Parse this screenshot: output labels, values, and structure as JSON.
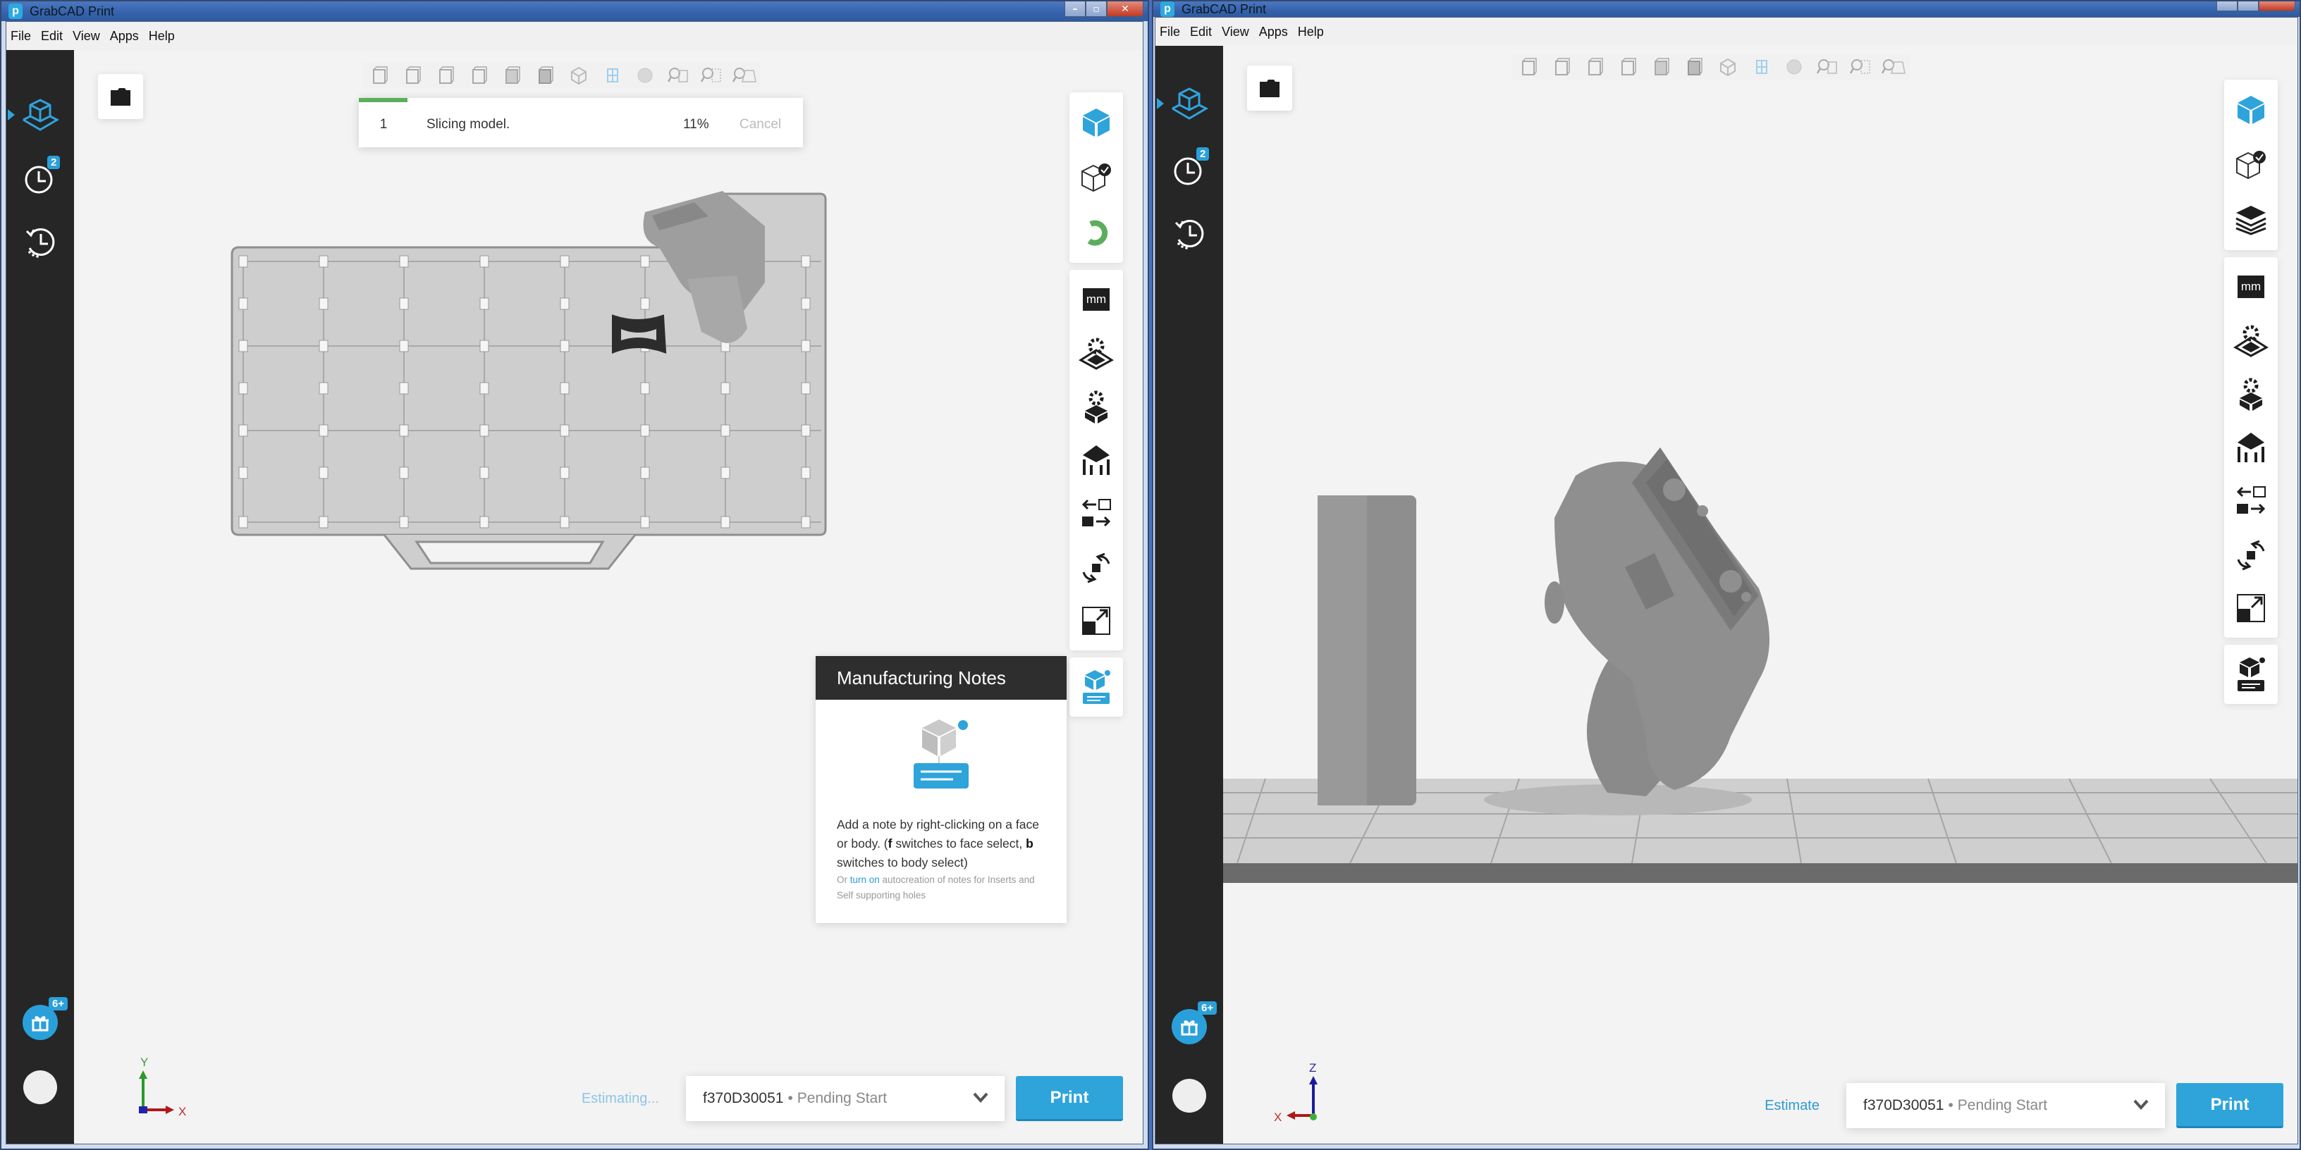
{
  "windows": [
    {
      "title": "GrabCAD Print",
      "menu": [
        "File",
        "Edit",
        "View",
        "Apps",
        "Help"
      ],
      "sidebar": {
        "items": [
          {
            "name": "prepare-icon",
            "active": true
          },
          {
            "name": "queue-icon",
            "badge": "2"
          },
          {
            "name": "history-icon"
          }
        ],
        "bottom": [
          {
            "name": "gift-icon",
            "badge": "6+"
          },
          {
            "name": "avatar"
          }
        ]
      },
      "view_toolbar": [
        "front-view",
        "back-view",
        "left-view",
        "right-view",
        "top-view",
        "bottom-view",
        "isometric-view",
        "wireframe-view",
        "shaded-view",
        "zoom-fit",
        "zoom-selection",
        "zoom-tray"
      ],
      "job": {
        "number": "1",
        "status": "Slicing model.",
        "percent_text": "11%",
        "progress": 0.11,
        "cancel_label": "Cancel"
      },
      "right_toolbar": {
        "group1": [
          "model-view-icon",
          "check-model-icon",
          "slicing-spinner-icon"
        ],
        "group2_units": "mm",
        "group2": [
          "tray-settings-icon",
          "model-settings-icon",
          "supports-icon",
          "arrange-icon",
          "orient-icon",
          "scale-icon"
        ],
        "group3": [
          "manufacturing-notes-icon"
        ]
      },
      "manufacturing_notes": {
        "title": "Manufacturing Notes",
        "text_part1": "Add a note by right-clicking on a face or body. (",
        "key_f": "f",
        "text_part2": " switches to face select, ",
        "key_b": "b",
        "text_part3": " switches to body select)",
        "sub_prefix": "Or ",
        "sub_link": "turn on",
        "sub_suffix": " autocreation of notes for Inserts and Self supporting holes"
      },
      "axes": {
        "vertical": "Y",
        "horizontal": "X"
      },
      "estimate_label": "Estimating...",
      "printer": {
        "name": "f370D30051",
        "separator": "•",
        "status": "Pending Start"
      },
      "print_label": "Print",
      "colors": {
        "accent": "#2ea4db",
        "progress": "#5cad5c",
        "sidebar": "#262626"
      }
    },
    {
      "title": "GrabCAD Print",
      "menu": [
        "File",
        "Edit",
        "View",
        "Apps",
        "Help"
      ],
      "sidebar": {
        "items": [
          {
            "name": "prepare-icon",
            "active": true
          },
          {
            "name": "queue-icon",
            "badge": "2"
          },
          {
            "name": "history-icon"
          }
        ],
        "bottom": [
          {
            "name": "gift-icon",
            "badge": "6+"
          },
          {
            "name": "avatar"
          }
        ]
      },
      "right_toolbar": {
        "group1": [
          "model-view-icon",
          "check-model-icon",
          "slice-layers-icon"
        ],
        "group2_units": "mm",
        "group2": [
          "tray-settings-icon",
          "model-settings-icon",
          "supports-icon",
          "arrange-icon",
          "orient-icon",
          "scale-icon"
        ],
        "group3": [
          "manufacturing-notes-icon"
        ]
      },
      "axes": {
        "vertical": "Z",
        "horizontal": "X"
      },
      "estimate_label": "Estimate",
      "printer": {
        "name": "f370D30051",
        "separator": "•",
        "status": "Pending Start"
      },
      "print_label": "Print"
    }
  ]
}
